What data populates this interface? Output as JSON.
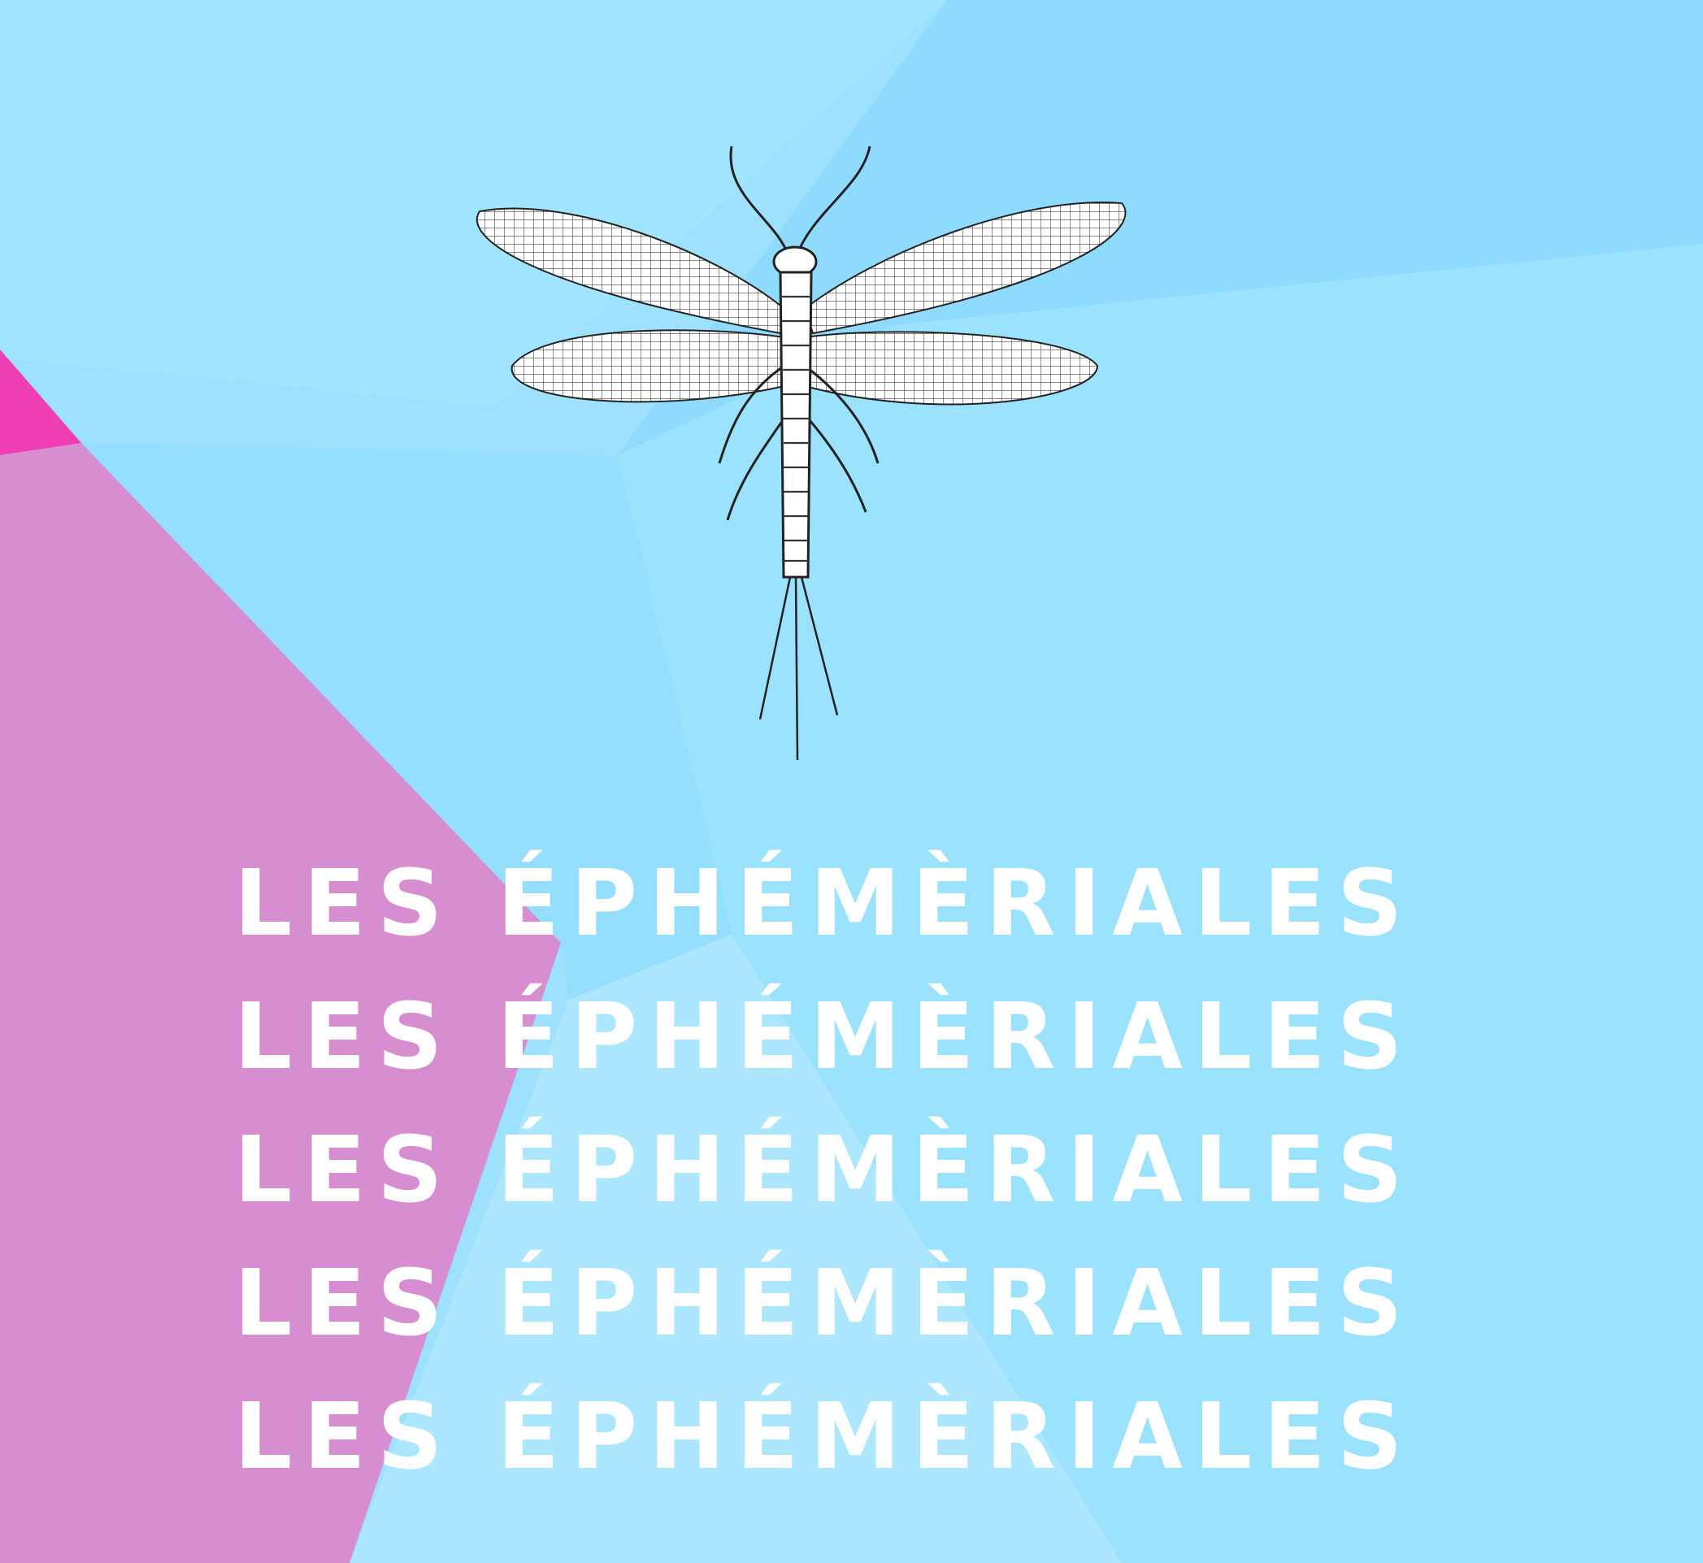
{
  "title_lines": [
    "LES ÉPHÉMÈRIALES",
    "LES ÉPHÉMÈRIALES",
    "LES ÉPHÉMÈRIALES",
    "LES ÉPHÉMÈRIALES",
    "LES ÉPHÉMÈRIALES"
  ],
  "illustration": "mayfly-icon",
  "colors": {
    "sky_blue": "#9ee1ff",
    "light_blue": "#aee6ff",
    "mid_blue": "#8fdcff",
    "violet": "#d68ed0",
    "magenta": "#f03fb4",
    "text": "#ffffff"
  }
}
